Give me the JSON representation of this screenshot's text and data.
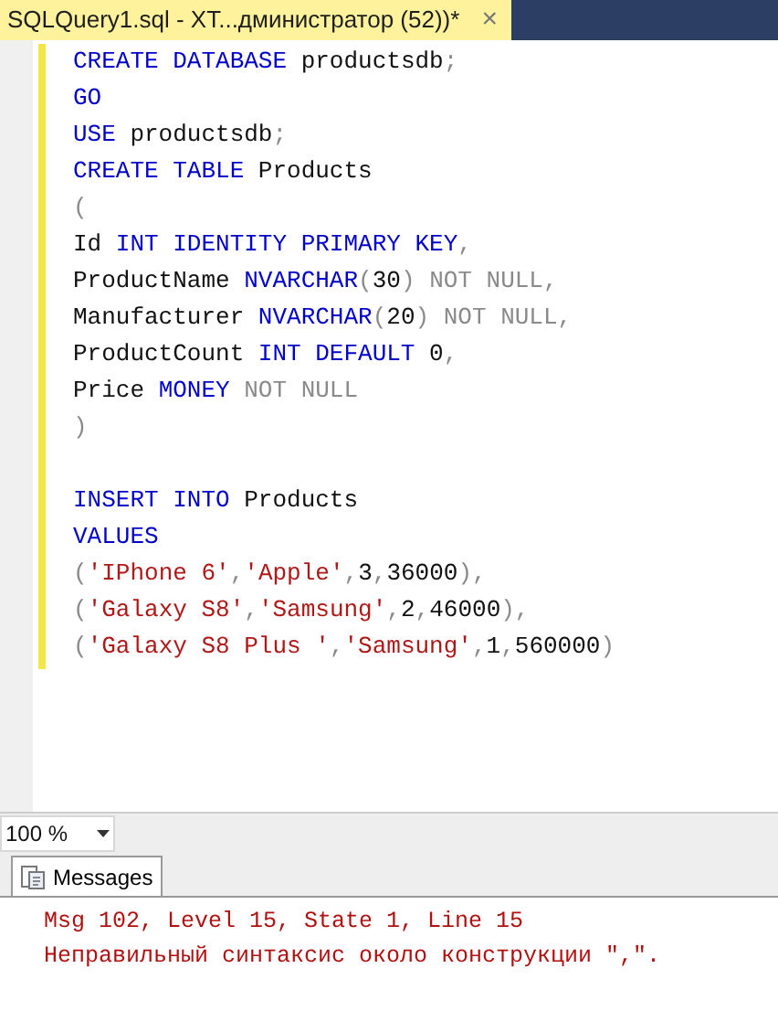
{
  "tab": {
    "title": "SQLQuery1.sql - XT...дминистратор (52))*",
    "close": "×",
    "selected": true
  },
  "editor": {
    "lines": [
      {
        "kind": "code",
        "tokens": [
          {
            "kind": "kw",
            "text": "CREATE DATABASE"
          },
          {
            "kind": "plain",
            "text": " productsdb"
          },
          {
            "kind": "gray",
            "text": ";"
          }
        ]
      },
      {
        "kind": "code",
        "tokens": [
          {
            "kind": "kw",
            "text": "GO"
          }
        ]
      },
      {
        "kind": "code",
        "tokens": [
          {
            "kind": "kw",
            "text": "USE"
          },
          {
            "kind": "plain",
            "text": " productsdb"
          },
          {
            "kind": "gray",
            "text": ";"
          }
        ]
      },
      {
        "kind": "code",
        "tokens": [
          {
            "kind": "kw",
            "text": "CREATE TABLE"
          },
          {
            "kind": "plain",
            "text": " Products"
          }
        ]
      },
      {
        "kind": "code",
        "tokens": [
          {
            "kind": "gray",
            "text": "("
          }
        ]
      },
      {
        "kind": "code",
        "tokens": [
          {
            "kind": "plain",
            "text": "Id "
          },
          {
            "kind": "kw",
            "text": "INT IDENTITY PRIMARY KEY"
          },
          {
            "kind": "gray",
            "text": ","
          }
        ]
      },
      {
        "kind": "code",
        "tokens": [
          {
            "kind": "plain",
            "text": "ProductName "
          },
          {
            "kind": "kw",
            "text": "NVARCHAR"
          },
          {
            "kind": "gray",
            "text": "("
          },
          {
            "kind": "plain",
            "text": "30"
          },
          {
            "kind": "gray",
            "text": ") NOT NULL,"
          }
        ]
      },
      {
        "kind": "code",
        "tokens": [
          {
            "kind": "plain",
            "text": "Manufacturer "
          },
          {
            "kind": "kw",
            "text": "NVARCHAR"
          },
          {
            "kind": "gray",
            "text": "("
          },
          {
            "kind": "plain",
            "text": "20"
          },
          {
            "kind": "gray",
            "text": ") NOT NULL,"
          }
        ]
      },
      {
        "kind": "code",
        "tokens": [
          {
            "kind": "plain",
            "text": "ProductCount "
          },
          {
            "kind": "kw",
            "text": "INT DEFAULT"
          },
          {
            "kind": "plain",
            "text": " 0"
          },
          {
            "kind": "gray",
            "text": ","
          }
        ]
      },
      {
        "kind": "code",
        "tokens": [
          {
            "kind": "plain",
            "text": "Price "
          },
          {
            "kind": "kw",
            "text": "MONEY"
          },
          {
            "kind": "gray",
            "text": " NOT NULL"
          }
        ]
      },
      {
        "kind": "code",
        "tokens": [
          {
            "kind": "gray",
            "text": ")"
          }
        ]
      },
      {
        "kind": "blank"
      },
      {
        "kind": "code",
        "tokens": [
          {
            "kind": "kw",
            "text": "INSERT INTO"
          },
          {
            "kind": "plain",
            "text": " Products"
          }
        ]
      },
      {
        "kind": "code",
        "tokens": [
          {
            "kind": "kw",
            "text": "VALUES"
          }
        ]
      },
      {
        "kind": "code",
        "tokens": [
          {
            "kind": "gray",
            "text": "("
          },
          {
            "kind": "str",
            "text": "'IPhone 6'"
          },
          {
            "kind": "gray",
            "text": ","
          },
          {
            "kind": "str",
            "text": "'Apple'"
          },
          {
            "kind": "gray",
            "text": ","
          },
          {
            "kind": "plain",
            "text": "3"
          },
          {
            "kind": "gray",
            "text": ","
          },
          {
            "kind": "plain",
            "text": "36000"
          },
          {
            "kind": "gray",
            "text": "),"
          }
        ]
      },
      {
        "kind": "code",
        "tokens": [
          {
            "kind": "gray",
            "text": "("
          },
          {
            "kind": "str",
            "text": "'Galaxy S8'"
          },
          {
            "kind": "gray",
            "text": ","
          },
          {
            "kind": "str",
            "text": "'Samsung'"
          },
          {
            "kind": "gray",
            "text": ","
          },
          {
            "kind": "plain",
            "text": "2"
          },
          {
            "kind": "gray",
            "text": ","
          },
          {
            "kind": "plain",
            "text": "46000"
          },
          {
            "kind": "gray",
            "text": "),"
          }
        ]
      },
      {
        "kind": "code",
        "tokens": [
          {
            "kind": "gray",
            "text": "("
          },
          {
            "kind": "str",
            "text": "'Galaxy S8 Plus '"
          },
          {
            "kind": "gray",
            "text": ","
          },
          {
            "kind": "str",
            "text": "'Samsung'"
          },
          {
            "kind": "gray",
            "text": ","
          },
          {
            "kind": "plain",
            "text": "1"
          },
          {
            "kind": "gray",
            "text": ","
          },
          {
            "kind": "plain",
            "text": "560000"
          },
          {
            "kind": "gray",
            "text": ")"
          }
        ]
      }
    ]
  },
  "zoom": {
    "value": "100 %"
  },
  "results_tabs": [
    {
      "label": "Messages",
      "selected": true
    }
  ],
  "messages": [
    "Msg 102, Level 15, State 1, Line 15",
    "Неправильный синтаксис около конструкции \",\"."
  ]
}
